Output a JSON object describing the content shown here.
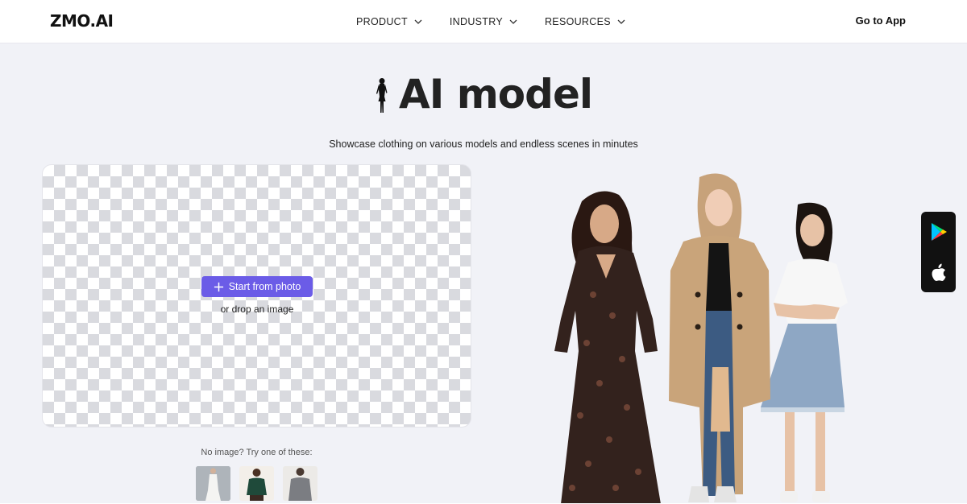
{
  "header": {
    "logo": "ZMO.AI",
    "nav": [
      {
        "label": "PRODUCT"
      },
      {
        "label": "INDUSTRY"
      },
      {
        "label": "RESOURCES"
      }
    ],
    "cta": "Go to App"
  },
  "hero": {
    "title": "AI model",
    "subtitle": "Showcase clothing on various models and endless scenes in minutes"
  },
  "upload": {
    "button_label": "Start from photo",
    "drop_text": "or drop an image",
    "try_text": "No image? Try one of these:"
  },
  "colors": {
    "accent": "#6b5ce7",
    "background": "#f1f2f7"
  },
  "app_widget": {
    "stores": [
      "google-play-icon",
      "apple-icon"
    ]
  }
}
